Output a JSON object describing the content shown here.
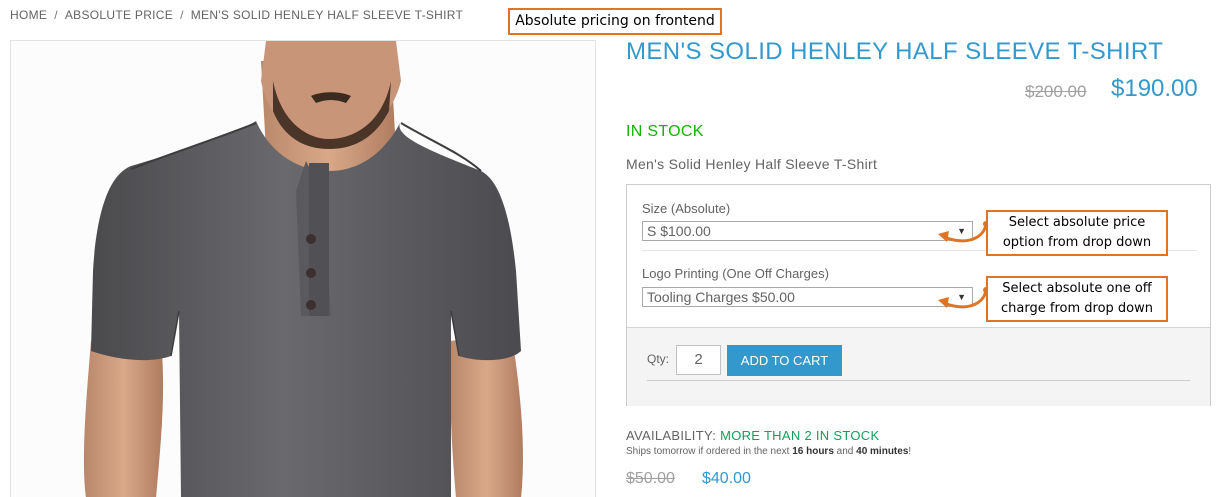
{
  "breadcrumb": {
    "home": "HOME",
    "sep": "/",
    "category": "ABSOLUTE PRICE",
    "current": "MEN'S SOLID HENLEY HALF SLEEVE T-SHIRT"
  },
  "callouts": {
    "top": "Absolute pricing on frontend",
    "size_line1": "Select absolute price",
    "size_line2": "option from drop down",
    "logo_line1": "Select absolute one off",
    "logo_line2": "charge from drop down"
  },
  "product": {
    "title": "MEN'S SOLID HENLEY HALF SLEEVE T-SHIRT",
    "old_price": "$200.00",
    "special_price": "$190.00",
    "stock_status": "IN STOCK",
    "short_description": "Men's Solid Henley Half Sleeve T-Shirt"
  },
  "options": {
    "size_label": "Size (Absolute)",
    "size_value": "S $100.00",
    "logo_label": "Logo Printing (One Off Charges)",
    "logo_value": "Tooling Charges $50.00",
    "arrow_glyph": "▼"
  },
  "cart": {
    "qty_label": "Qty:",
    "qty_value": "2",
    "add_to_cart": "ADD TO CART"
  },
  "availability": {
    "label": "AVAILABILITY:",
    "value": "MORE THAN 2 IN STOCK",
    "ships_prefix": "Ships tomorrow if ordered in the next",
    "ships_hours": "16 hours",
    "ships_and": "and",
    "ships_minutes": "40 minutes",
    "ships_suffix": "!",
    "old_price": "$50.00",
    "special_price": "$40.00"
  },
  "colors": {
    "accent": "#3399cc",
    "in_stock": "#11b400",
    "callout_border": "#e07422"
  }
}
